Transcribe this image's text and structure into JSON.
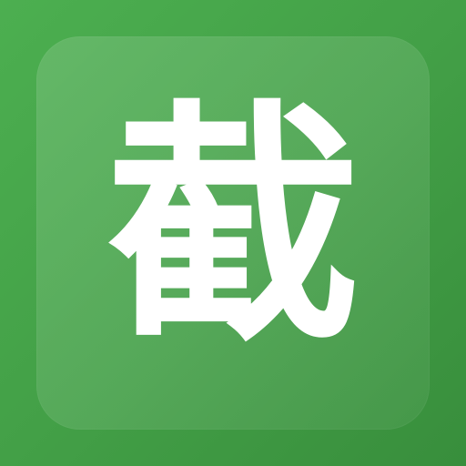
{
  "app_icon": {
    "glyph": "截"
  },
  "colors": {
    "background": "#43a047",
    "tile": "rgba(255,255,255,0.12)",
    "glyph": "#ffffff"
  }
}
